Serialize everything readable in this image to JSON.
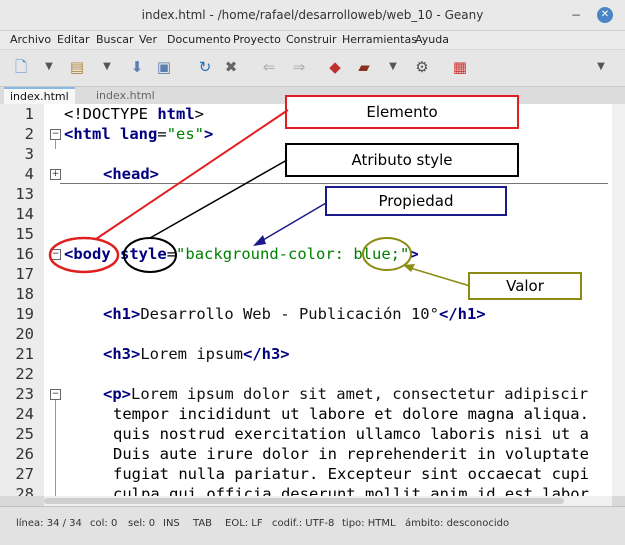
{
  "window": {
    "title": "index.html - /home/rafael/desarrolloweb/web_10 - Geany",
    "minimize": "−",
    "close": "✕"
  },
  "menu": [
    "Archivo",
    "Editar",
    "Buscar",
    "Ver",
    "Documento",
    "Proyecto",
    "Construir",
    "Herramientas",
    "Ayuda"
  ],
  "tabs": [
    "index.html",
    "index.html"
  ],
  "line_numbers": [
    "1",
    "2",
    "3",
    "4",
    "13",
    "14",
    "15",
    "16",
    "17",
    "18",
    "19",
    "20",
    "21",
    "22",
    "23",
    "24",
    "25",
    "26",
    "27",
    "28"
  ],
  "code": {
    "l1_a": "<!DOCTYPE ",
    "l1_b": "html",
    "l1_c": ">",
    "l2_tag": "<html",
    "l2_attr": "lang",
    "l2_eq": "=",
    "l2_str": "\"es\"",
    "l2_end": ">",
    "l4": "<head>",
    "l16_tag": "<body",
    "l16_attr": "style",
    "l16_eq": "=",
    "l16_str": "\"background-color: blue;\"",
    "l16_end": ">",
    "l19_open": "<h1>",
    "l19_text": "Desarrollo Web - Publicación 10°",
    "l19_close": "</h1>",
    "l21_open": "<h3>",
    "l21_text": "Lorem ipsum",
    "l21_close": "</h3>",
    "l23_open": "<p>",
    "l23_text": "Lorem ipsum dolor sit amet, consectetur adipiscir",
    "l24": "tempor incididunt ut labore et dolore magna aliqua.",
    "l25": "quis nostrud exercitation ullamco laboris nisi ut a",
    "l26": "Duis aute irure dolor in reprehenderit in voluptate",
    "l27": "fugiat nulla pariatur. Excepteur sint occaecat cupi",
    "l28": "culpa qui officia deserunt mollit anim id est labor"
  },
  "annotations": {
    "elemento": "Elemento",
    "atributo": "Atributo style",
    "propiedad": "Propiedad",
    "valor": "Valor",
    "colors": {
      "red": "#e02020",
      "black": "#000000",
      "navy": "#1a1a8c",
      "olive": "#8c8c14"
    }
  },
  "status": {
    "linea": "línea: 34 / 34",
    "col": "col: 0",
    "sel": "sel: 0",
    "ins": "INS",
    "tab": "TAB",
    "eol": "EOL: LF",
    "codif": "codif.: UTF-8",
    "tipo": "tipo: HTML",
    "ambito": "ámbito: desconocido"
  },
  "icons": [
    "new-file-icon",
    "open-file-icon",
    "save-icon",
    "save-all-icon",
    "reload-icon",
    "close-file-icon",
    "back-icon",
    "forward-icon",
    "compile-icon",
    "build-icon",
    "preferences-icon",
    "color-chooser-icon"
  ]
}
